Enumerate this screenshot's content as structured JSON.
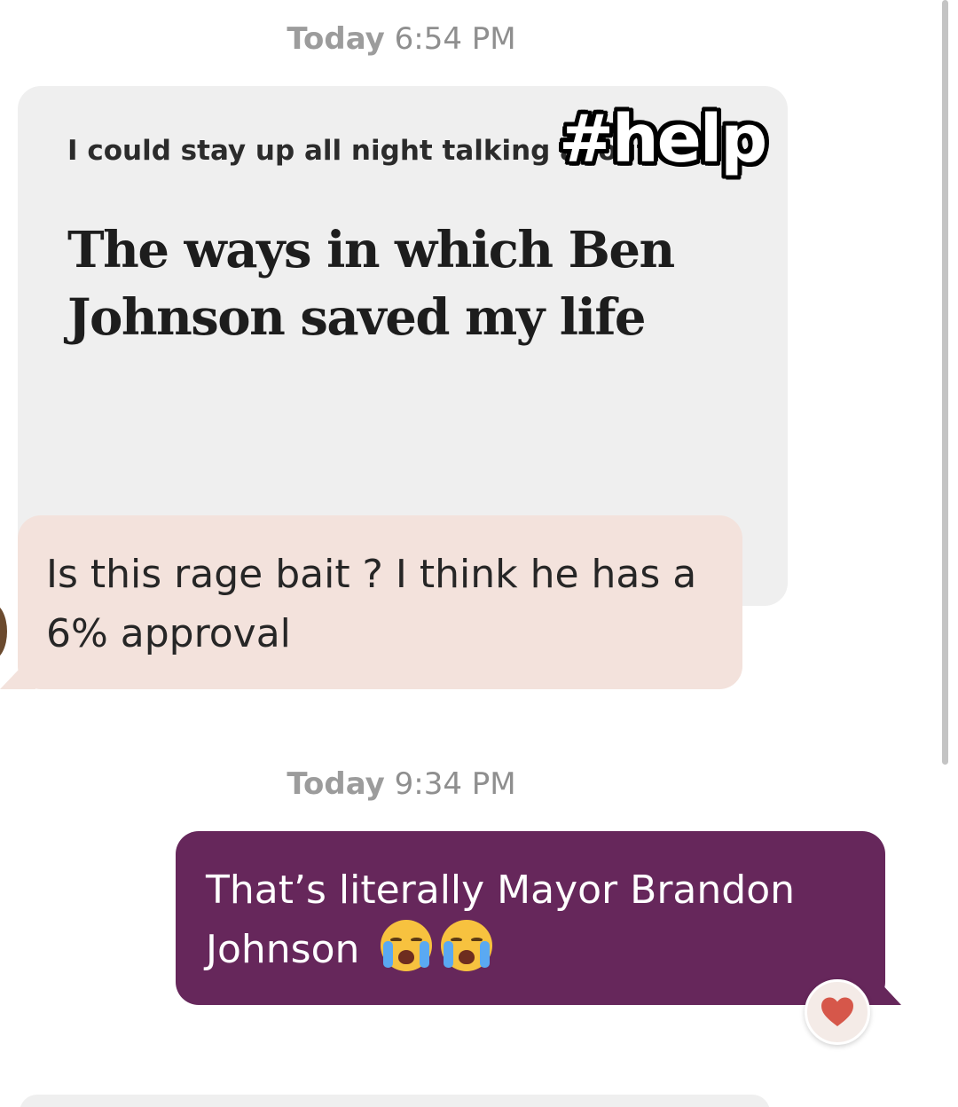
{
  "timestamps": [
    {
      "day": "Today",
      "time": "6:54 PM"
    },
    {
      "day": "Today",
      "time": "9:34 PM"
    }
  ],
  "prompt": {
    "label": "I could stay up all night talking about",
    "answer": "The ways in which Ben Johnson saved my life"
  },
  "overlay": {
    "hashtag": "#help"
  },
  "received": {
    "text": "Is this rage bait ? I think he has a 6% approval"
  },
  "sent": {
    "text": "That’s literally Mayor Brandon Johnson",
    "emojis": [
      "loudly-crying-face",
      "loudly-crying-face"
    ]
  },
  "reaction": {
    "icon": "heart-icon",
    "color": "#d6574a"
  },
  "colors": {
    "sent_bubble": "#66275b",
    "received_bubble": "#f3e2dc",
    "prompt_card": "#efefef"
  }
}
